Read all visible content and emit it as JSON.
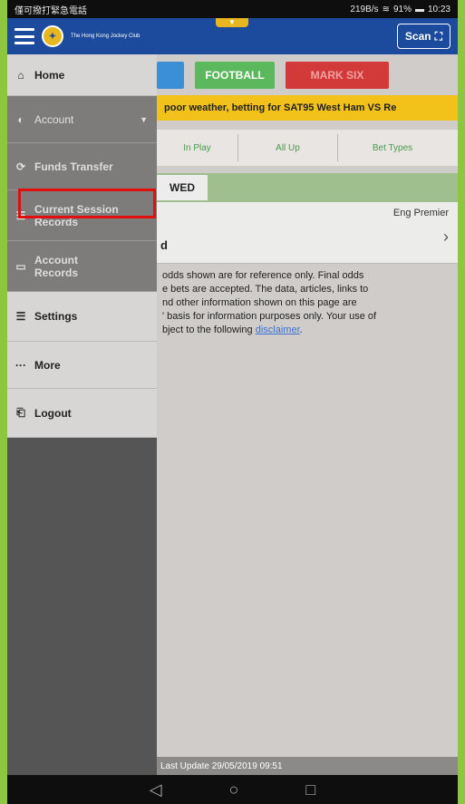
{
  "status_bar": {
    "left_text": "僅可撥打緊急電話",
    "right_text": "219B/s",
    "battery": "91%",
    "time": "10:23"
  },
  "top_bar": {
    "logo_text": "The Hong Kong Jockey Club",
    "scan_label": "Scan"
  },
  "sport_tabs": [
    {
      "label": ""
    },
    {
      "label": "FOOTBALL"
    },
    {
      "label": "MARK SIX"
    }
  ],
  "announcement": "poor weather, betting for SAT95 West Ham VS Re",
  "sub_tabs": [
    "In Play",
    "All Up",
    "Bet Types"
  ],
  "day_tab": "WED",
  "match": {
    "league": "Eng Premier",
    "name": "d"
  },
  "disclaimer": {
    "text": " odds shown are for reference only. Final odds\ne bets are accepted. The data, articles, links to\nnd other information shown on this page are\n' basis for information purposes only. Your use of\nbject to the following ",
    "link_text": "disclaimer",
    "end": "."
  },
  "last_update": "Last Update 29/05/2019 09:51",
  "drawer": {
    "items": [
      {
        "label": "Home",
        "icon": "home-icon"
      },
      {
        "label": "Account",
        "icon": "person-icon"
      },
      {
        "label": "Funds Transfer",
        "icon": "refresh-icon"
      },
      {
        "label": "Current Session Records",
        "icon": "list-icon"
      },
      {
        "label": "Account Records",
        "icon": "card-icon"
      },
      {
        "label": "Settings",
        "icon": "settings-icon"
      },
      {
        "label": "More",
        "icon": "more-icon"
      },
      {
        "label": "Logout",
        "icon": "logout-icon"
      }
    ]
  },
  "colors": {
    "brand_blue": "#1c4a9c",
    "football_green": "#5cb85c",
    "marksix_red": "#d23a3a",
    "announcement_yellow": "#f2c21b",
    "highlight_red": "#e20f0f",
    "outer_green": "#8dc63f"
  }
}
